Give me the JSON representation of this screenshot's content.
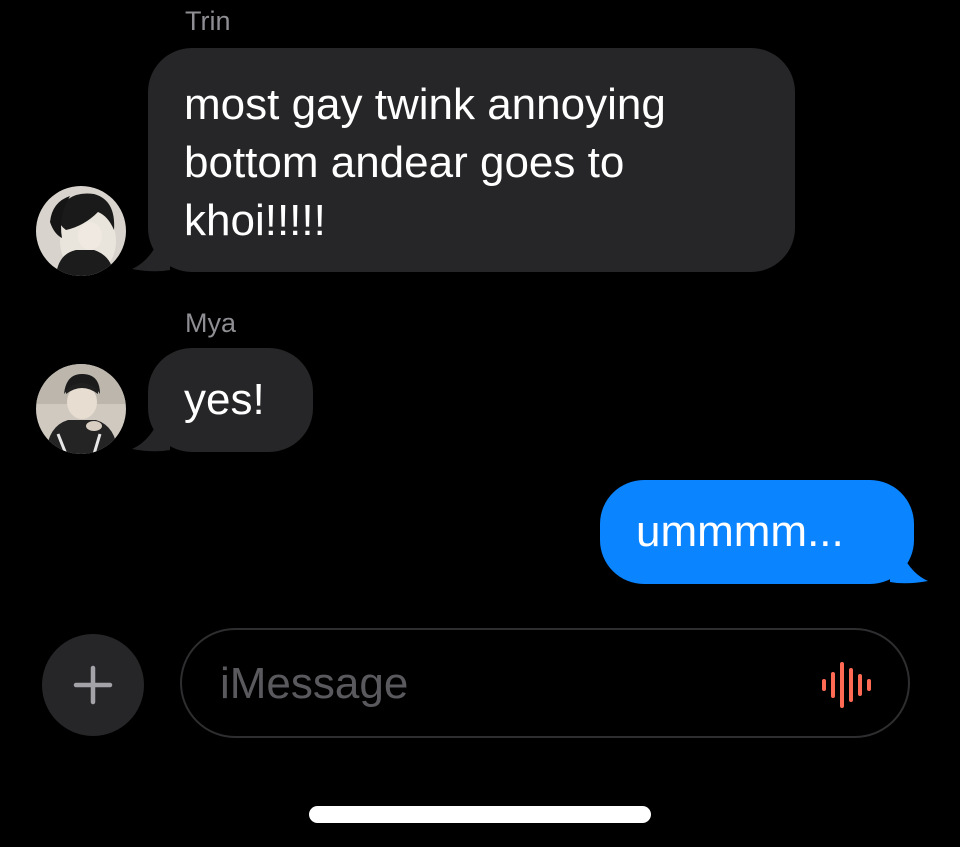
{
  "thread": {
    "messages": [
      {
        "sender": "Trin",
        "direction": "incoming",
        "text": "most gay twink annoying bottom andear goes to khoi!!!!!"
      },
      {
        "sender": "Mya",
        "direction": "incoming",
        "text": "yes!"
      },
      {
        "sender": "",
        "direction": "outgoing",
        "text": "ummmm..."
      }
    ],
    "colors": {
      "incoming_bubble": "#262628",
      "outgoing_bubble": "#0a84ff",
      "background": "#000000",
      "sender_name": "#8e8e93",
      "audio_icon": "#ff6a55"
    }
  },
  "composer": {
    "add_icon": "plus-icon",
    "placeholder": "iMessage",
    "audio_icon": "waveform-icon"
  }
}
